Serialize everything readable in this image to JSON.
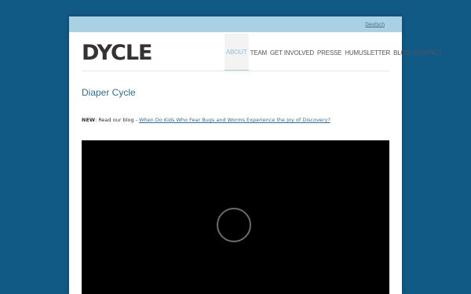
{
  "topbar": {
    "language_link": "Deutsch"
  },
  "logo": "DYCLE",
  "nav": {
    "items": [
      "ABOUT",
      "TEAM",
      "GET INVOLVED",
      "PRESSE",
      "HUMUSLETTER",
      "BLOG",
      "CONTACT"
    ],
    "active": "ABOUT"
  },
  "main": {
    "title": "Diaper Cycle",
    "news_label": "NEW",
    "news_text": ": Read our blog - ",
    "news_link": "When Do Kids Who Fear Bugs and Worms Experience the Joy of Discovery?"
  },
  "colors": {
    "background": "#125a86",
    "topbar": "#a9d0e3",
    "accent": "#2f6f8f"
  },
  "icons": {
    "video_play": "circle-play-icon"
  }
}
